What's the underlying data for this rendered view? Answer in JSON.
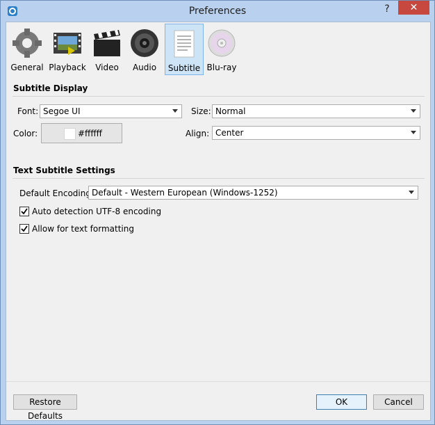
{
  "window": {
    "title": "Preferences",
    "help_label": "?",
    "close_label": "✕"
  },
  "toolbar": {
    "items": [
      {
        "label": "General",
        "icon": "gear-icon"
      },
      {
        "label": "Playback",
        "icon": "film-strip-icon"
      },
      {
        "label": "Video",
        "icon": "clapperboard-icon"
      },
      {
        "label": "Audio",
        "icon": "speaker-icon"
      },
      {
        "label": "Subtitle",
        "icon": "document-icon"
      },
      {
        "label": "Blu-ray",
        "icon": "disc-icon"
      }
    ],
    "active": "Subtitle"
  },
  "subtitle_display": {
    "title": "Subtitle Display",
    "font_label": "Font:",
    "font_value": "Segoe UI",
    "size_label": "Size:",
    "size_value": "Normal",
    "color_label": "Color:",
    "color_value": "#ffffff",
    "align_label": "Align:",
    "align_value": "Center"
  },
  "text_subtitle": {
    "title": "Text Subtitle Settings",
    "encoding_label": "Default Encoding:",
    "encoding_value": "Default - Western European (Windows-1252)",
    "auto_detect_label": "Auto detection UTF-8 encoding",
    "auto_detect_checked": true,
    "formatting_label": "Allow for text formatting",
    "formatting_checked": true
  },
  "footer": {
    "restore_label": "Restore Defaults",
    "ok_label": "OK",
    "cancel_label": "Cancel"
  },
  "colors": {
    "accent": "#7eb4ea",
    "close": "#c7483e",
    "frame": "#b9d1ee"
  }
}
